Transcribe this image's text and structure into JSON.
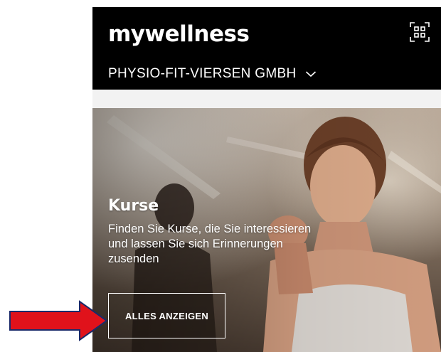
{
  "header": {
    "app_title": "mywellness",
    "club_name": "PHYSIO-FIT-VIERSEN GMBH",
    "qr_icon": "qr-code-scan-icon",
    "dropdown_icon": "chevron-down-icon"
  },
  "card": {
    "title": "Kurse",
    "description": "Finden Sie Kurse, die Sie interessieren und lassen Sie sich Erinnerungen zusenden",
    "button_label": "ALLES ANZEIGEN"
  },
  "colors": {
    "header_bg": "#000000",
    "text_on_dark": "#ffffff",
    "annotation_arrow": "#e0121b",
    "annotation_arrow_outline": "#1a2a6a"
  }
}
